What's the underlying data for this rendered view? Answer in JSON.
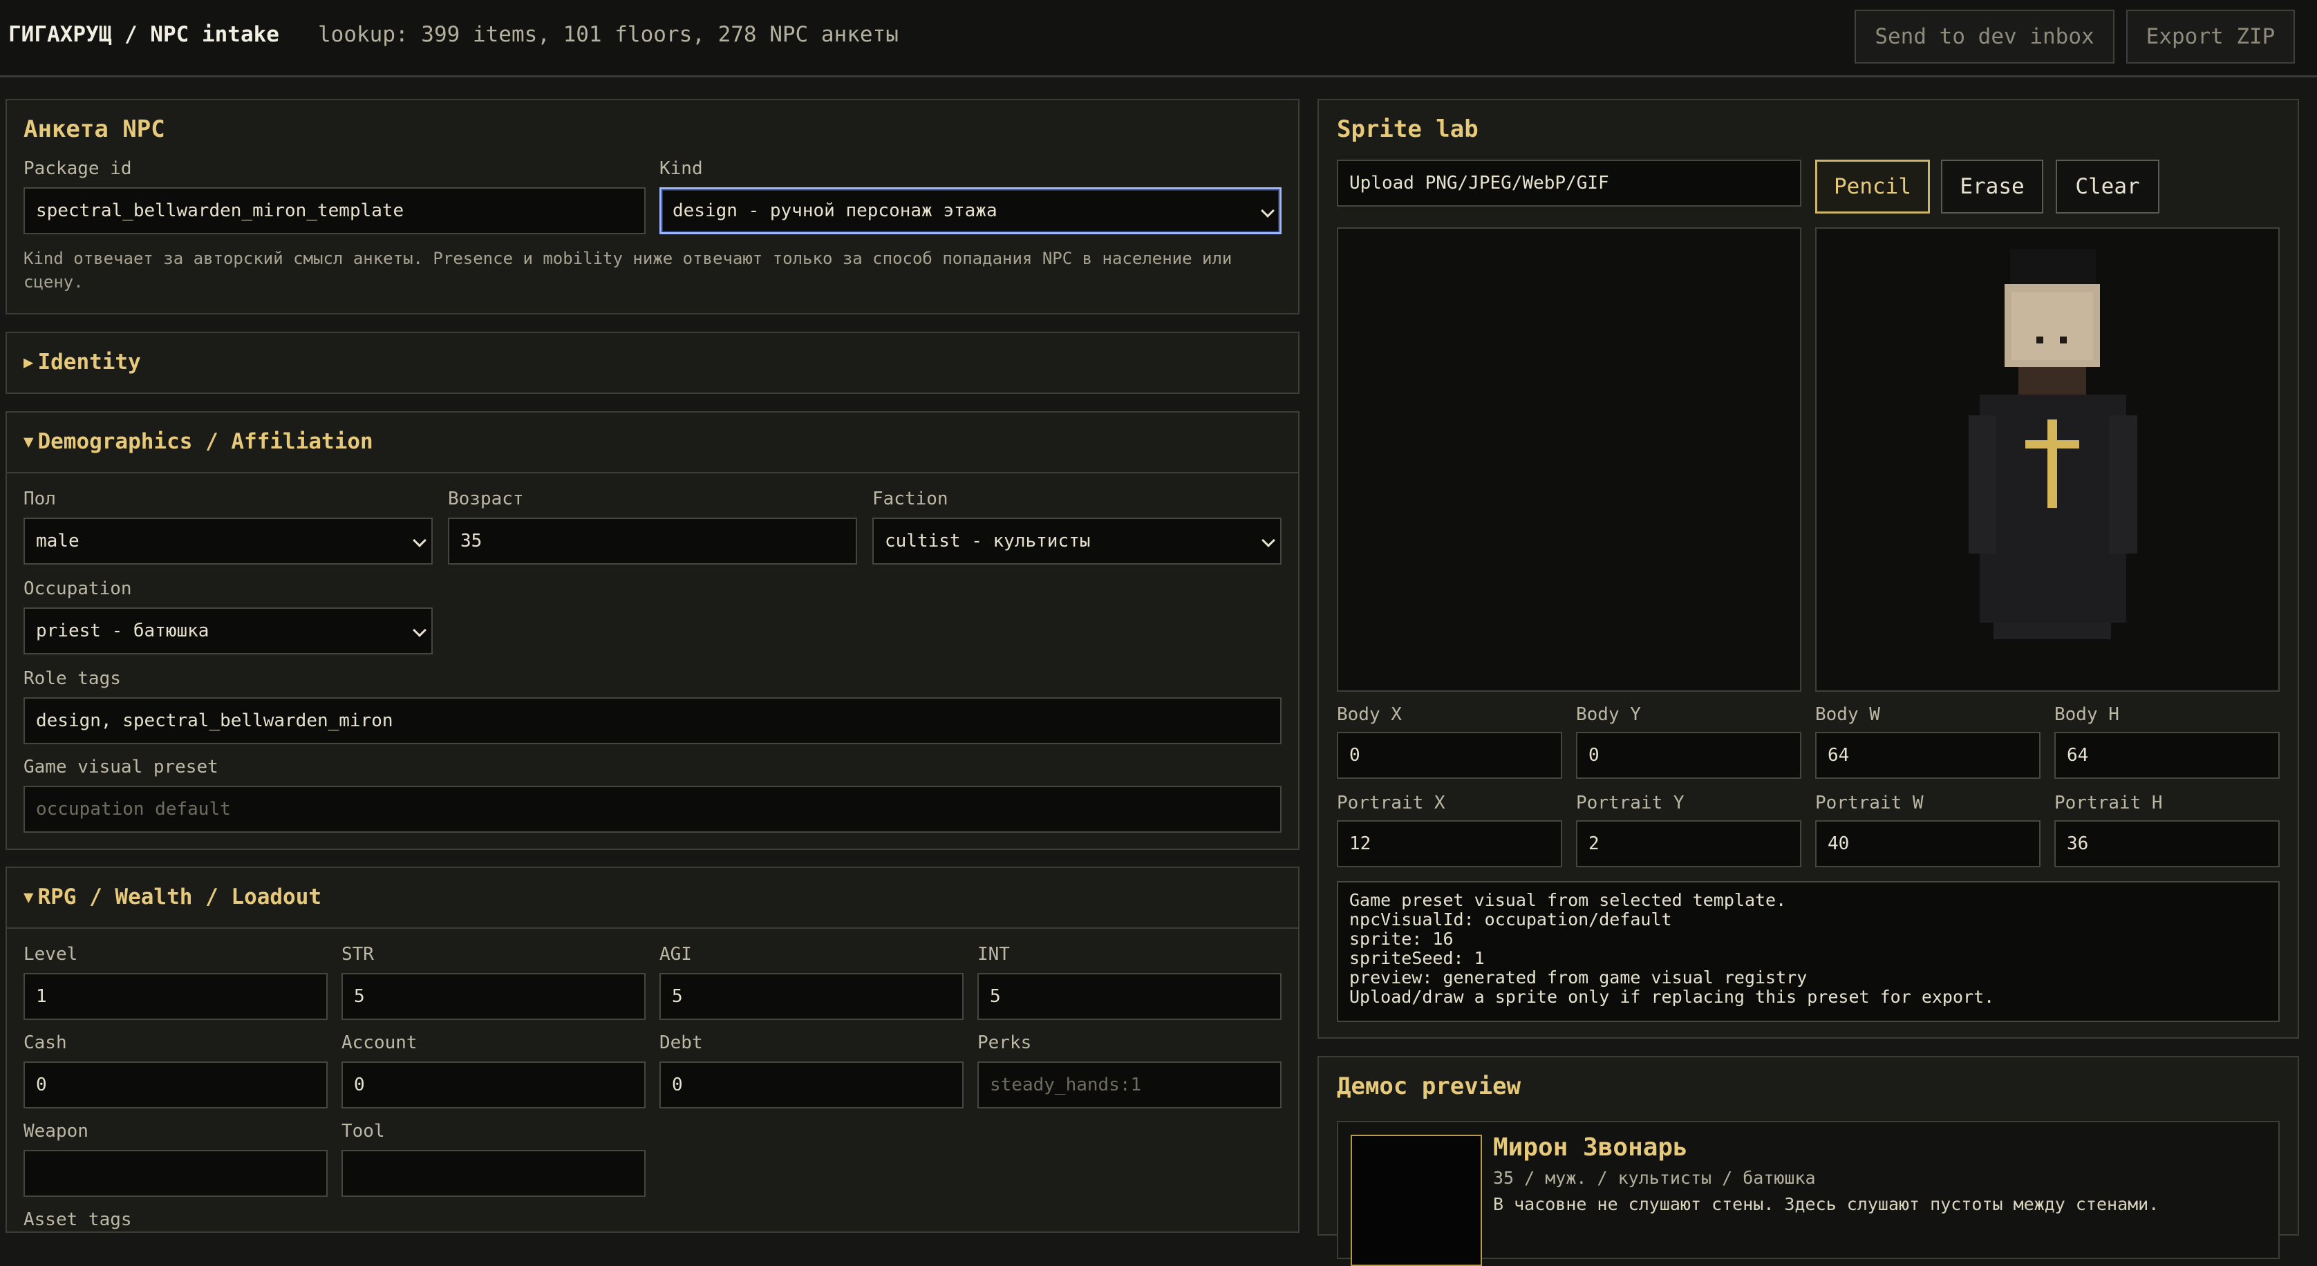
{
  "topbar": {
    "title": "ГИГАХРУЩ / NPC intake",
    "lookup": "lookup: 399 items, 101 floors, 278 NPC анкеты",
    "send_btn": "Send to dev inbox",
    "export_btn": "Export ZIP"
  },
  "anketa": {
    "title": "Анкета NPC",
    "package_label": "Package id",
    "package_value": "spectral_bellwarden_miron_template",
    "kind_label": "Kind",
    "kind_value": "design - ручной персонаж этажа",
    "hint": "Kind отвечает за авторский смысл анкеты. Presence и mobility ниже отвечают только за способ попадания NPC в население или сцену."
  },
  "identity": {
    "title": "Identity",
    "arrow": "▶"
  },
  "demographics": {
    "title": "Demographics / Affiliation",
    "arrow": "▼",
    "sex_label": "Пол",
    "sex_value": "male",
    "age_label": "Возраст",
    "age_value": "35",
    "faction_label": "Faction",
    "faction_value": "cultist - культисты",
    "occupation_label": "Occupation",
    "occupation_value": "priest - батюшка",
    "role_tags_label": "Role tags",
    "role_tags_value": "design, spectral_bellwarden_miron",
    "visual_preset_label": "Game visual preset",
    "visual_preset_placeholder": "occupation default"
  },
  "rpg": {
    "title": "RPG / Wealth / Loadout",
    "arrow": "▼",
    "level_label": "Level",
    "level_value": "1",
    "str_label": "STR",
    "str_value": "5",
    "agi_label": "AGI",
    "agi_value": "5",
    "int_label": "INT",
    "int_value": "5",
    "cash_label": "Cash",
    "cash_value": "0",
    "account_label": "Account",
    "account_value": "0",
    "debt_label": "Debt",
    "debt_value": "0",
    "perks_label": "Perks",
    "perks_placeholder": "steady_hands:1",
    "weapon_label": "Weapon",
    "weapon_value": "",
    "tool_label": "Tool",
    "tool_value": "",
    "asset_tags_label": "Asset tags"
  },
  "sprite_lab": {
    "title": "Sprite lab",
    "upload": "Upload PNG/JPEG/WebP/GIF",
    "pencil": "Pencil",
    "erase": "Erase",
    "clear": "Clear",
    "body_x_label": "Body X",
    "body_x": "0",
    "body_y_label": "Body Y",
    "body_y": "0",
    "body_w_label": "Body W",
    "body_w": "64",
    "body_h_label": "Body H",
    "body_h": "64",
    "portrait_x_label": "Portrait X",
    "portrait_x": "12",
    "portrait_y_label": "Portrait Y",
    "portrait_y": "2",
    "portrait_w_label": "Portrait W",
    "portrait_w": "40",
    "portrait_h_label": "Portrait H",
    "portrait_h": "36",
    "info_lines": [
      "Game preset visual from selected template.",
      "npcVisualId: occupation/default",
      "sprite: 16",
      "spriteSeed: 1",
      "preview: generated from game visual registry",
      "Upload/draw a sprite only if replacing this preset for export."
    ]
  },
  "demos": {
    "title": "Демос preview",
    "name": "Мирон Звонарь",
    "meta": "35 / муж. / культисты / батюшка",
    "quote": "В часовне не слушают стены. Здесь слушают пустоты между стенами."
  },
  "colors": {
    "accent": "#e6c97a",
    "background": "#161714",
    "panel": "#1b1c18",
    "field": "#0b0b0a",
    "focus": "#9fb7ff"
  }
}
